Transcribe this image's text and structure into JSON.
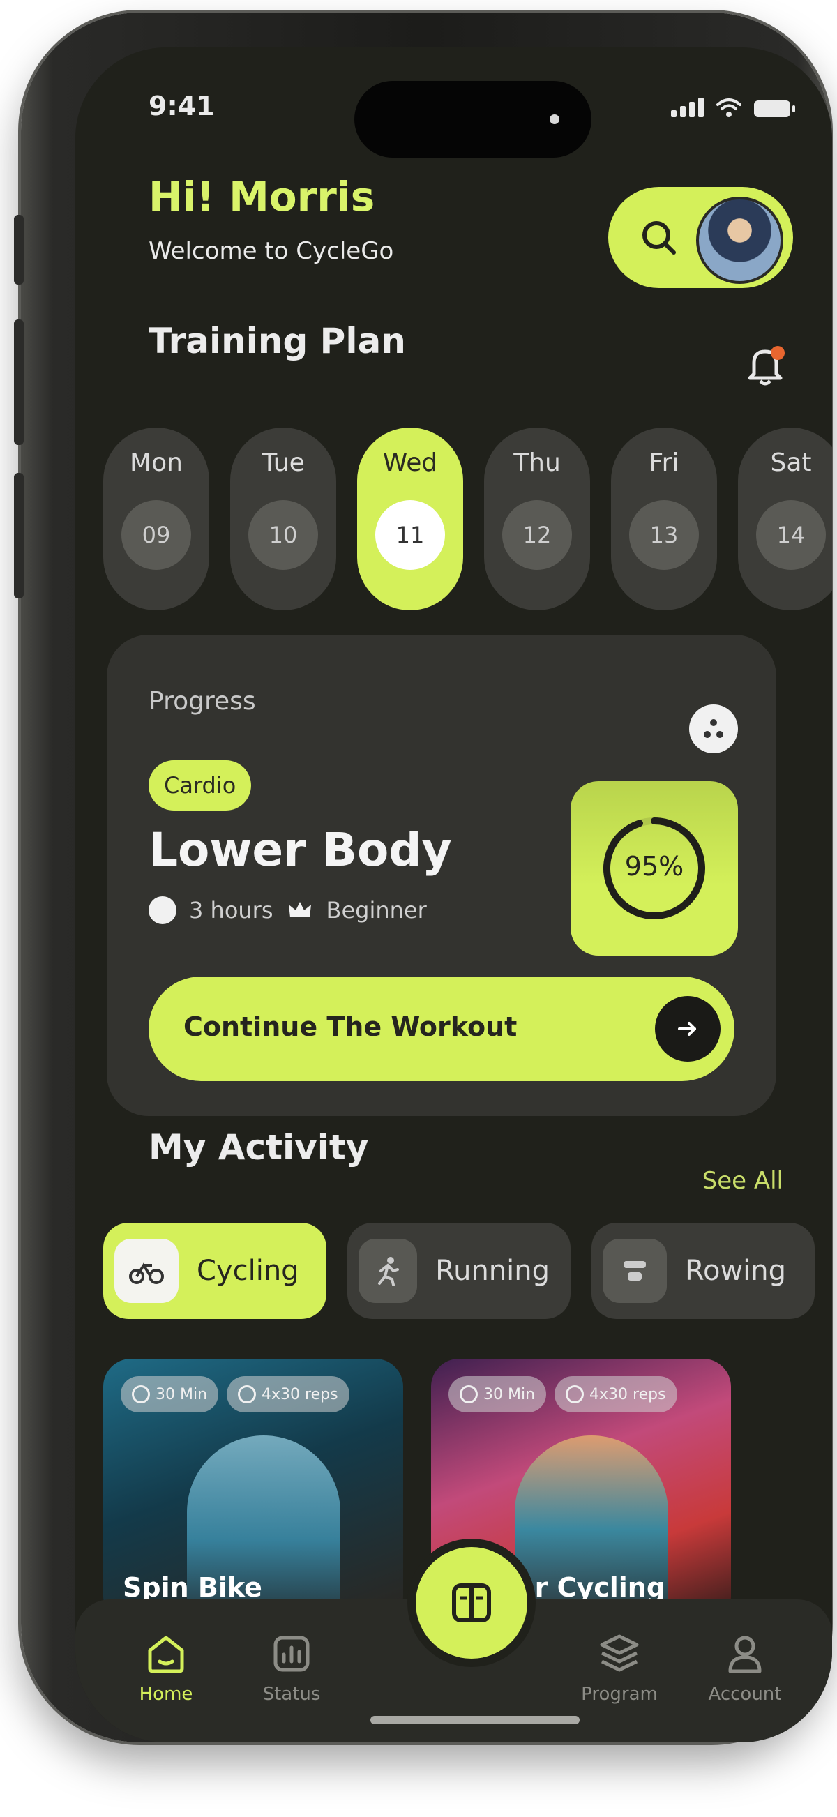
{
  "status": {
    "time": "9:41"
  },
  "header": {
    "greeting": "Hi! Morris",
    "welcome": "Welcome to CycleGo"
  },
  "training": {
    "title": "Training Plan",
    "days": [
      {
        "name": "Mon",
        "num": "09",
        "active": false
      },
      {
        "name": "Tue",
        "num": "10",
        "active": false
      },
      {
        "name": "Wed",
        "num": "11",
        "active": true
      },
      {
        "name": "Thu",
        "num": "12",
        "active": false
      },
      {
        "name": "Fri",
        "num": "13",
        "active": false
      },
      {
        "name": "Sat",
        "num": "14",
        "active": false
      }
    ]
  },
  "progress": {
    "label": "Progress",
    "tag": "Cardio",
    "title": "Lower Body",
    "duration": "3 hours",
    "level": "Beginner",
    "percent": "95%",
    "percent_value": 95,
    "cta": "Continue The Workout"
  },
  "activity": {
    "title": "My Activity",
    "see_all": "See All",
    "chips": [
      {
        "label": "Cycling",
        "icon": "bike-icon",
        "active": true
      },
      {
        "label": "Running",
        "icon": "run-icon",
        "active": false
      },
      {
        "label": "Rowing",
        "icon": "rowing-icon",
        "active": false
      }
    ],
    "cards": [
      {
        "title": "Spin Bike",
        "tag1": "30 Min",
        "tag2": "4x30 reps"
      },
      {
        "title": "Indoor Cycling",
        "tag1": "30 Min",
        "tag2": "4x30 reps"
      }
    ]
  },
  "tabbar": {
    "home": "Home",
    "status": "Status",
    "program": "Program",
    "account": "Account"
  },
  "colors": {
    "accent": "#d4f05a",
    "background": "#20211b",
    "card": "#33332f"
  }
}
